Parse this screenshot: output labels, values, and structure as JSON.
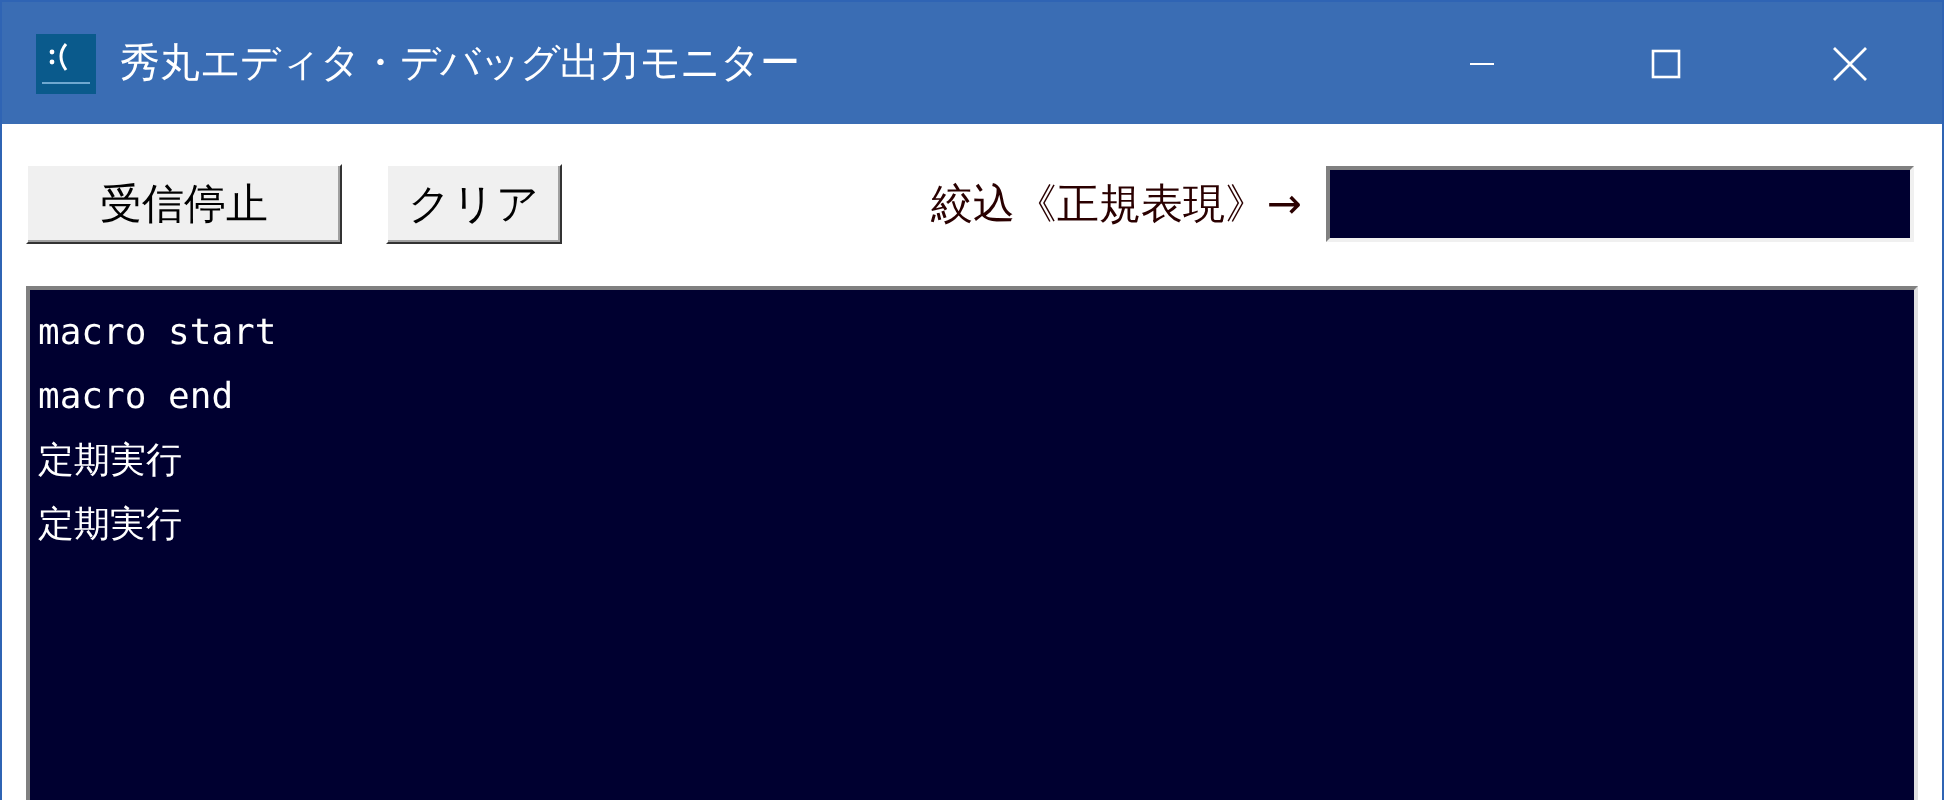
{
  "window": {
    "title": "秀丸エディタ・デバッグ出力モニター"
  },
  "toolbar": {
    "buttons": [
      "受信停止",
      "クリア"
    ],
    "filter_label": "絞込《正規表現》→"
  },
  "output": {
    "lines": [
      "macro start",
      "macro end",
      "定期実行",
      "定期実行"
    ]
  }
}
